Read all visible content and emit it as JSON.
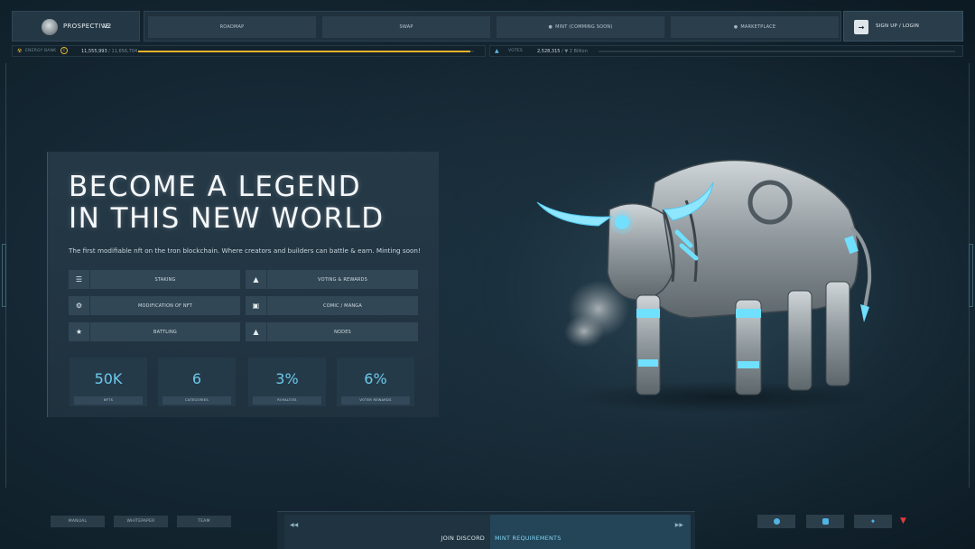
{
  "brand": {
    "name": "PROSPECTIVE",
    "version": "V2",
    "logo_icon": "bull-logo-icon"
  },
  "nav": {
    "items": [
      {
        "label": "ROADMAP",
        "locked": false
      },
      {
        "label": "SWAP",
        "locked": false
      },
      {
        "label": "MINT (COMMING SOON)",
        "locked": true
      },
      {
        "label": "MARKETPLACE",
        "locked": true
      }
    ],
    "signup_label": "SIGN UP / LOGIN"
  },
  "energy_bank": {
    "label": "ENERGY BANK",
    "current": "11,555,993",
    "max": "11,656,704",
    "fill_fraction": 0.99,
    "color": "#e6b32a"
  },
  "votes": {
    "label": "VOTES",
    "current": "2,528,315",
    "max": "2 Billion",
    "fill_fraction": 0.0
  },
  "hero": {
    "title_line1": "BECOME A LEGEND",
    "title_line2": "IN THIS NEW WORLD",
    "subtitle": "The first modifiable nft on the tron blockchain. Where creators and builders can battle & earn. Minting soon!",
    "features": [
      {
        "label": "STAKING",
        "icon": "coins-icon"
      },
      {
        "label": "VOTING & REWARDS",
        "icon": "thumbs-up-icon"
      },
      {
        "label": "MODIFICATION OF NFT",
        "icon": "gear-icon"
      },
      {
        "label": "COMIC / MANGA",
        "icon": "book-icon"
      },
      {
        "label": "BATTLING",
        "icon": "trophy-icon"
      },
      {
        "label": "NODES",
        "icon": "flame-icon"
      }
    ],
    "stats": [
      {
        "value": "50K",
        "label": "NFTS"
      },
      {
        "value": "6",
        "label": "CATEGORIES"
      },
      {
        "value": "3%",
        "label": "ROYALTIES"
      },
      {
        "value": "6%",
        "label": "VOTER REWARDS"
      }
    ]
  },
  "footer": {
    "left_buttons": [
      "MANUAL",
      "WHITEPAPER",
      "TEAM"
    ],
    "join_discord": "JOIN DISCORD",
    "mint_requirements": "MINT REQUIREMENTS",
    "socials": [
      "discord-icon",
      "instagram-icon",
      "twitter-icon",
      "tron-icon"
    ]
  },
  "colors": {
    "accent": "#6cc9ec",
    "energy": "#e6b32a",
    "tron": "#e23b3b"
  }
}
